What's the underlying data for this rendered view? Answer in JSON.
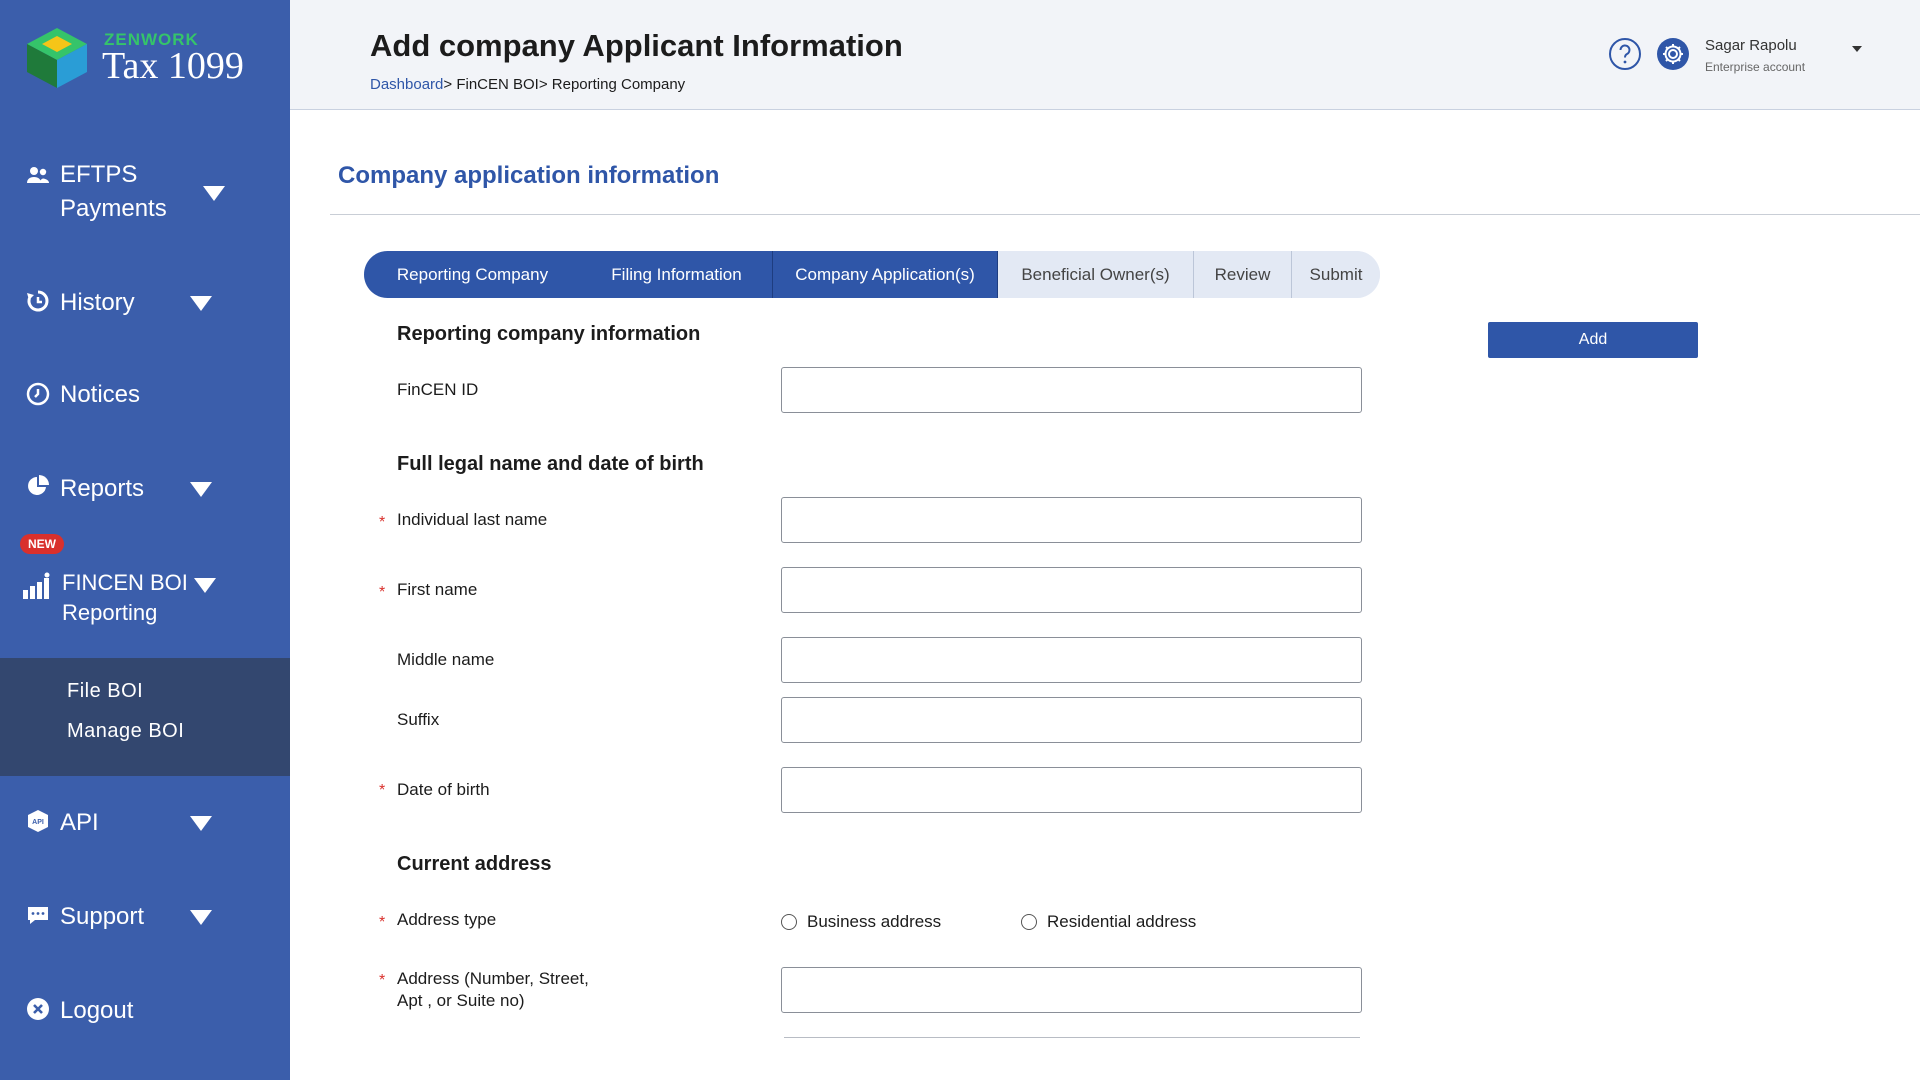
{
  "brand": {
    "company": "ZENWORK",
    "product": "Tax 1099"
  },
  "sidebar": {
    "items": [
      {
        "id": "eftps",
        "label_line1": "EFTPS",
        "label_line2": "Payments",
        "icon": "people-icon",
        "has_caret": true
      },
      {
        "id": "history",
        "label": "History",
        "icon": "history-icon",
        "has_caret": true
      },
      {
        "id": "notices",
        "label": "Notices",
        "icon": "clock-icon",
        "has_caret": false
      },
      {
        "id": "reports",
        "label": "Reports",
        "icon": "pie-chart-icon",
        "has_caret": true
      },
      {
        "id": "fincen",
        "label_line1": "FINCEN BOI",
        "label_line2": "Reporting",
        "icon": "bar-chart-icon",
        "has_caret": true,
        "badge": "NEW"
      },
      {
        "id": "api",
        "label": "API",
        "icon": "api-icon",
        "has_caret": true
      },
      {
        "id": "support",
        "label": "Support",
        "icon": "chat-icon",
        "has_caret": true
      },
      {
        "id": "logout",
        "label": "Logout",
        "icon": "close-circle-icon",
        "has_caret": false
      }
    ],
    "submenu": [
      "File BOI",
      "Manage BOI"
    ]
  },
  "header": {
    "title": "Add company Applicant Information",
    "breadcrumb": {
      "link": "Dashboard",
      "sep1": ">",
      "middle": " FinCEN BOI",
      "sep2": ">",
      "current": " Reporting Company"
    },
    "user": {
      "name": "Sagar Rapolu",
      "role": "Enterprise account"
    }
  },
  "main": {
    "section_title": "Company application information",
    "steps": [
      {
        "label": "Reporting Company",
        "state": "done"
      },
      {
        "label": "Filing Information",
        "state": "done"
      },
      {
        "label": "Company Application(s)",
        "state": "current"
      },
      {
        "label": "Beneficial Owner(s)",
        "state": "todo"
      },
      {
        "label": "Review",
        "state": "todo"
      },
      {
        "label": "Submit",
        "state": "todo"
      }
    ],
    "add_button": "Add",
    "group_reporting": "Reporting company information",
    "fincen_id_label": "FinCEN ID",
    "group_name": "Full legal name and date of birth",
    "last_name_label": "Individual last name",
    "first_name_label": "First name",
    "middle_name_label": "Middle name",
    "suffix_label": "Suffix",
    "dob_label": "Date of birth",
    "group_address": "Current address",
    "address_type_label": "Address type",
    "address_type_options": [
      "Business address",
      "Residential address"
    ],
    "address_label_line1": "Address (Number, Street,",
    "address_label_line2": "Apt , or Suite no)",
    "required_mark": "*"
  },
  "colors": {
    "sidebar": "#3b5eab",
    "submenu": "#33476f",
    "accent": "#2f56a8",
    "brand_green": "#35c46a",
    "required": "#d9302c"
  }
}
